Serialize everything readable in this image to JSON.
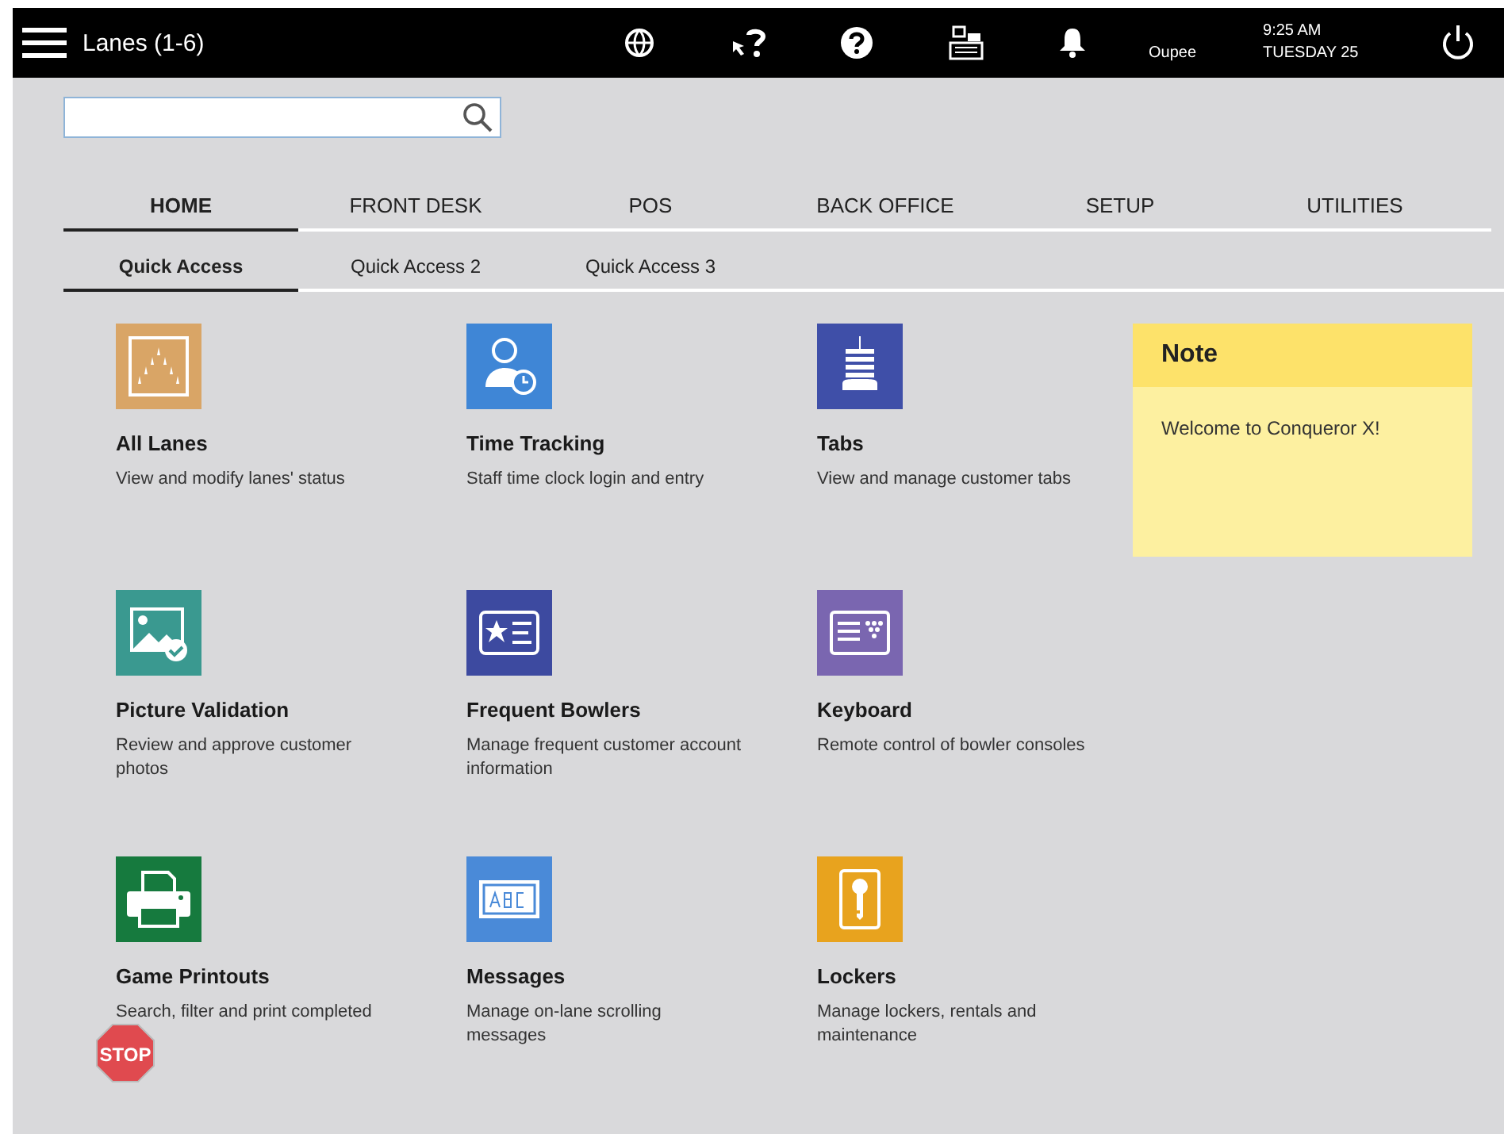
{
  "top_bar": {
    "title": "Lanes (1-6)",
    "user": "Oupee",
    "time": "9:25 AM",
    "date": "TUESDAY 25"
  },
  "main_tabs": [
    {
      "label": "HOME",
      "selected": true
    },
    {
      "label": "FRONT DESK",
      "selected": false
    },
    {
      "label": "POS",
      "selected": false
    },
    {
      "label": "BACK OFFICE",
      "selected": false
    },
    {
      "label": "SETUP",
      "selected": false
    },
    {
      "label": "UTILITIES",
      "selected": false
    }
  ],
  "sub_tabs": [
    {
      "label": "Quick Access",
      "selected": true
    },
    {
      "label": "Quick Access 2",
      "selected": false
    },
    {
      "label": "Quick Access 3",
      "selected": false
    }
  ],
  "tiles": [
    {
      "kind": "lanes",
      "color": "#d9a566",
      "title": "All Lanes",
      "description": "View and modify lanes' status"
    },
    {
      "kind": "clock",
      "color": "#3f86d6",
      "title": "Time Tracking",
      "description": "Staff time clock login and entry"
    },
    {
      "kind": "tabs",
      "color": "#3f4fa8",
      "title": "Tabs",
      "description": "View and manage customer tabs"
    },
    {
      "kind": "picture",
      "color": "#3a9990",
      "title": "Picture Validation",
      "description": "Review and approve customer photos"
    },
    {
      "kind": "card",
      "color": "#3d4aa0",
      "title": "Frequent Bowlers",
      "description": "Manage frequent customer account information"
    },
    {
      "kind": "keyboard",
      "color": "#7a66b0",
      "title": "Keyboard",
      "description": "Remote control of bowler consoles"
    },
    {
      "kind": "printer",
      "color": "#167a3e",
      "title": "Game Printouts",
      "description": "Search, filter and print completed"
    },
    {
      "kind": "messages",
      "color": "#4a8ad8",
      "title": "Messages",
      "description": "Manage on-lane scrolling messages"
    },
    {
      "kind": "key",
      "color": "#e8a31e",
      "title": "Lockers",
      "description": "Manage lockers, rentals and maintenance"
    }
  ],
  "note": {
    "title": "Note",
    "text": "Welcome to Conqueror X!"
  },
  "stop_badge": {
    "label": "STOP"
  }
}
